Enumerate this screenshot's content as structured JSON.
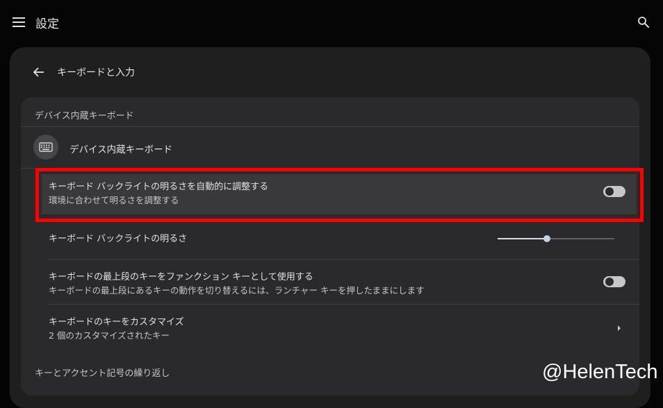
{
  "app": {
    "title": "設定"
  },
  "icons": {
    "menu": "menu-icon",
    "search": "search-icon",
    "back": "back-arrow-icon",
    "keyboard": "keyboard-icon",
    "chevron": "chevron-right-icon"
  },
  "colors": {
    "background": "#050505",
    "panel": "#1f1f20",
    "card": "#2a2a2c",
    "highlight_frame": "#ff0000",
    "toggle_off": "#c7c7cb",
    "slider_active": "#d6dbe6"
  },
  "page": {
    "title": "キーボードと入力"
  },
  "device_keyboard": {
    "section_header": "デバイス内蔵キーボード",
    "device_label": "デバイス内蔵キーボード",
    "auto_backlight": {
      "title": "キーボード バックライトの明るさを自動的に調整する",
      "subtitle": "環境に合わせて明るさを調整する",
      "enabled": false
    },
    "backlight_brightness": {
      "title": "キーボード バックライトの明るさ",
      "level": 0.42
    },
    "top_row_function_keys": {
      "title": "キーボードの最上段のキーをファンクション キーとして使用する",
      "subtitle": "キーボードの最上段にあるキーの動作を切り替えるには、ランチャー キーを押したままにします",
      "enabled": false
    },
    "customize_keys": {
      "title": "キーボードのキーをカスタマイズ",
      "subtitle": "2 個のカスタマイズされたキー"
    }
  },
  "accent_section": {
    "header": "キーとアクセント記号の繰り返し"
  },
  "watermark": {
    "text": "@HelenTech"
  }
}
